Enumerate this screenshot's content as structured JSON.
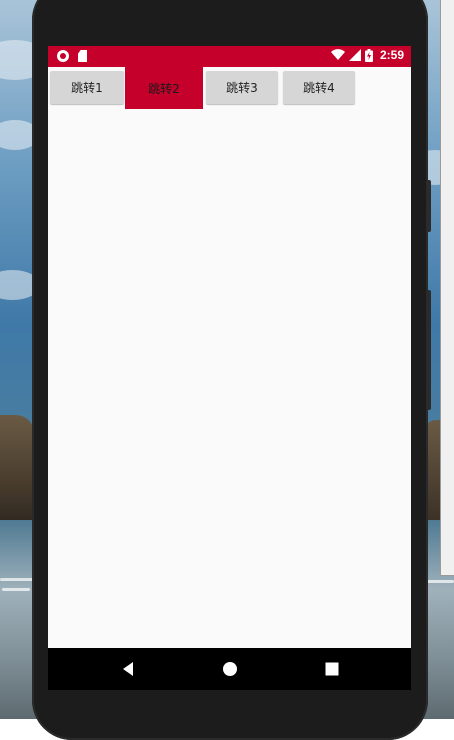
{
  "status_bar": {
    "time": "2:59",
    "left_icons": [
      "record-icon",
      "sd-card-icon"
    ],
    "right_icons": [
      "wifi-icon",
      "signal-icon",
      "battery-charging-icon"
    ]
  },
  "tabs": [
    {
      "label": "跳转1",
      "active": false
    },
    {
      "label": "跳转2",
      "active": true
    },
    {
      "label": "跳转3",
      "active": false
    },
    {
      "label": "跳转4",
      "active": false
    }
  ],
  "nav_bar": {
    "buttons": [
      "back-icon",
      "home-icon",
      "recents-icon"
    ]
  },
  "colors": {
    "accent": "#c4002b",
    "tab_inactive": "#d6d6d6",
    "screen_bg": "#fafafa",
    "nav_bg": "#000000"
  }
}
